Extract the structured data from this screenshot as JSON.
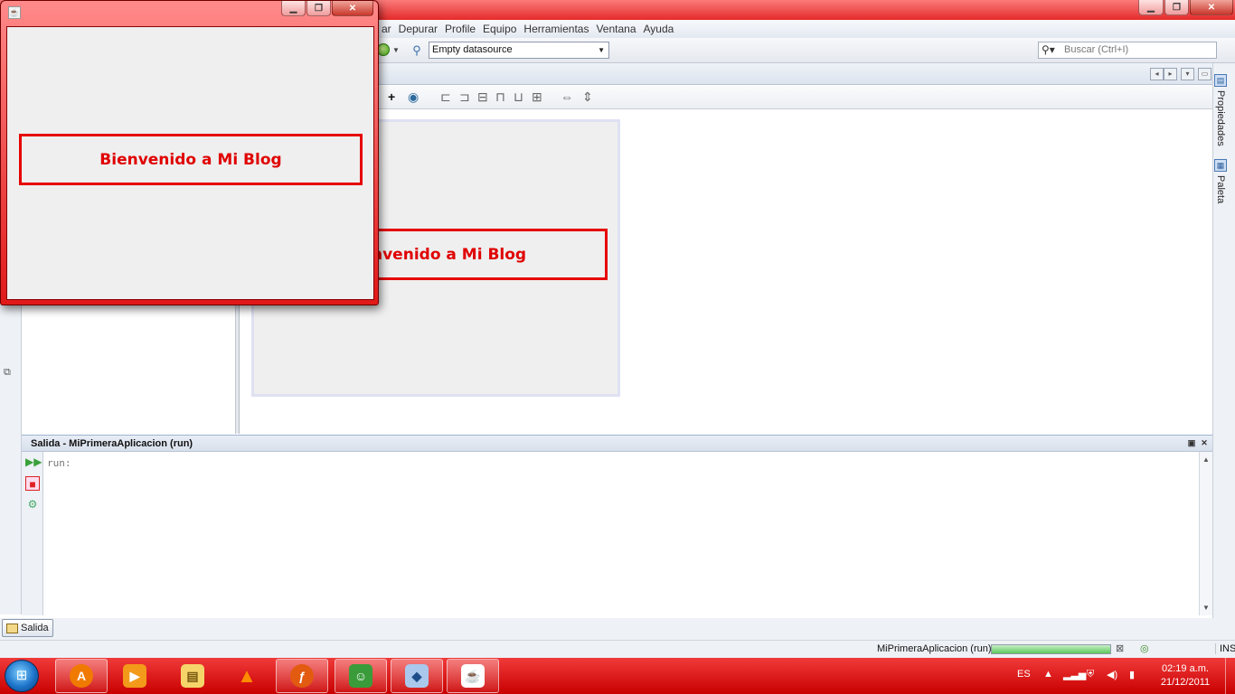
{
  "ide": {
    "menu": [
      "ar",
      "Depurar",
      "Profile",
      "Equipo",
      "Herramientas",
      "Ventana",
      "Ayuda"
    ],
    "datasource": "Empty datasource",
    "search_placeholder": "Buscar (Ctrl+I)",
    "design_label": "nvenido a Mi Blog",
    "right_tabs": [
      "Propiedades",
      "Paleta"
    ],
    "output": {
      "title": "Salida - MiPrimeraAplicacion (run)",
      "text": "run:",
      "tab_label": "Salida"
    },
    "status": {
      "task": "MiPrimeraAplicacion (run)",
      "mode": "INS"
    }
  },
  "app_window": {
    "label": "Bienvenido a Mi Blog"
  },
  "taskbar": {
    "lang": "ES",
    "time": "02:19 a.m.",
    "date": "21/12/2011",
    "apps": [
      "avast-icon",
      "media-player-icon",
      "file-explorer-icon",
      "vlc-icon",
      "firefox-icon",
      "messenger-icon",
      "virtualbox-icon",
      "java-icon"
    ]
  },
  "colors": {
    "accent_red": "#e60000",
    "taskbar": "#d80000"
  }
}
